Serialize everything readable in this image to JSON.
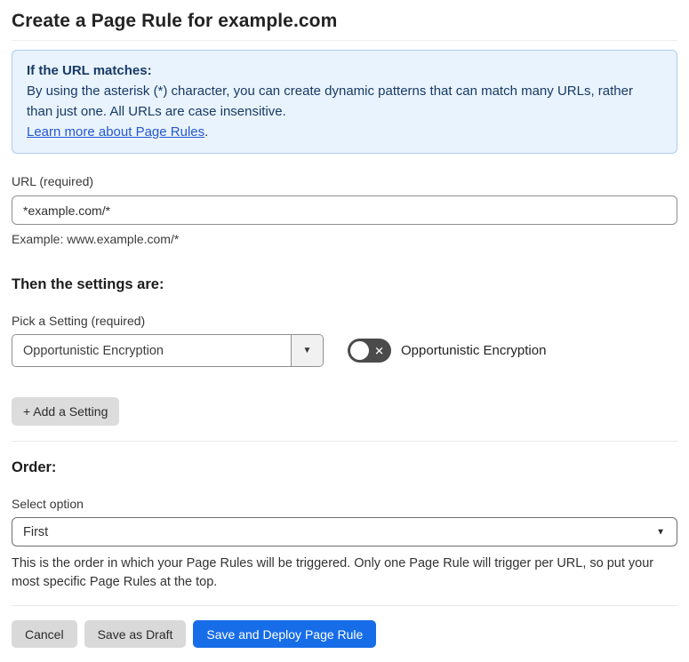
{
  "page": {
    "title": "Create a Page Rule for example.com"
  },
  "info_box": {
    "heading": "If the URL matches:",
    "body": "By using the asterisk (*) character, you can create dynamic patterns that can match many URLs, rather than just one. All URLs are case insensitive.",
    "link_label": "Learn more about Page Rules",
    "link_suffix": "."
  },
  "url_field": {
    "label": "URL (required)",
    "value": "*example.com/*",
    "helper": "Example: www.example.com/*"
  },
  "settings_section": {
    "heading": "Then the settings are:",
    "picker_label": "Pick a Setting (required)",
    "picker_value": "Opportunistic Encryption",
    "toggle_label": "Opportunistic Encryption",
    "toggle_state": "off",
    "add_setting_button": "+ Add a Setting"
  },
  "order_section": {
    "heading": "Order:",
    "select_label": "Select option",
    "select_value": "First",
    "helper": "This is the order in which your Page Rules will be triggered. Only one Page Rule will trigger per URL, so put your most specific Page Rules at the top."
  },
  "footer": {
    "cancel_label": "Cancel",
    "save_draft_label": "Save as Draft",
    "save_deploy_label": "Save and Deploy Page Rule"
  },
  "icons": {
    "caret_down_glyph": "▼",
    "x_glyph": "✕"
  },
  "colors": {
    "info_bg": "#e9f3fd",
    "info_border": "#abcdf0",
    "info_text": "#173a66",
    "link": "#2458cf",
    "primary_button": "#176de8",
    "grey_button": "#d9d9d9",
    "toggle_off": "#4b4b4b"
  }
}
